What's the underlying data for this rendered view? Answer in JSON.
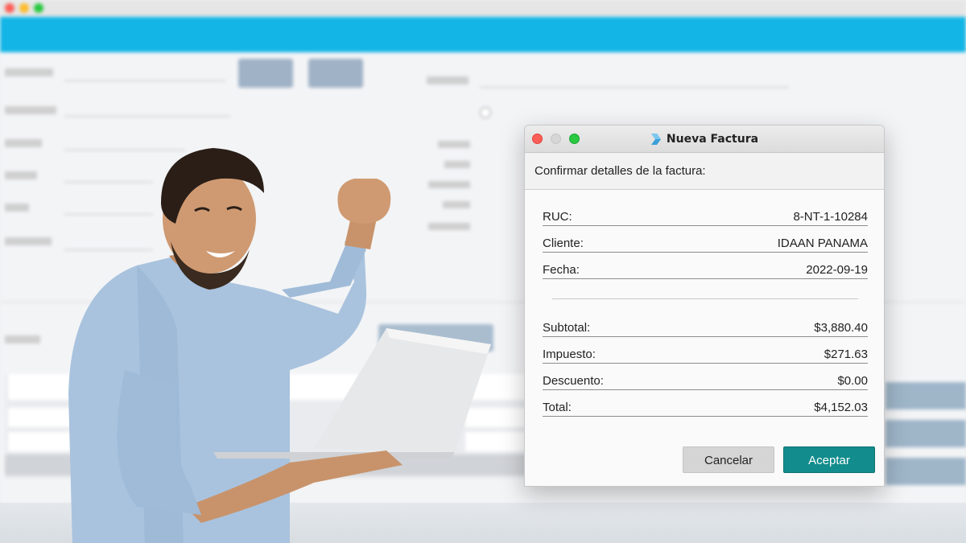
{
  "dialog": {
    "title": "Nueva Factura",
    "subheader": "Confirmar detalles de la factura:",
    "rows_info": [
      {
        "label": "RUC:",
        "value": "8-NT-1-10284"
      },
      {
        "label": "Cliente:",
        "value": "IDAAN PANAMA"
      },
      {
        "label": "Fecha:",
        "value": "2022-09-19"
      }
    ],
    "rows_totals": [
      {
        "label": "Subtotal:",
        "value": "$3,880.40"
      },
      {
        "label": "Impuesto:",
        "value": "$271.63"
      },
      {
        "label": "Descuento:",
        "value": "$0.00"
      },
      {
        "label": "Total:",
        "value": "$4,152.03"
      }
    ],
    "cancel_label": "Cancelar",
    "accept_label": "Aceptar"
  },
  "colors": {
    "accent_nav": "#12b5e6",
    "accept_button": "#128c8c",
    "cancel_button": "#d5d5d5"
  },
  "icons": {
    "dialog_app": "app-logo-icon",
    "traffic_lights": [
      "close-icon",
      "minimize-icon",
      "maximize-icon"
    ]
  }
}
